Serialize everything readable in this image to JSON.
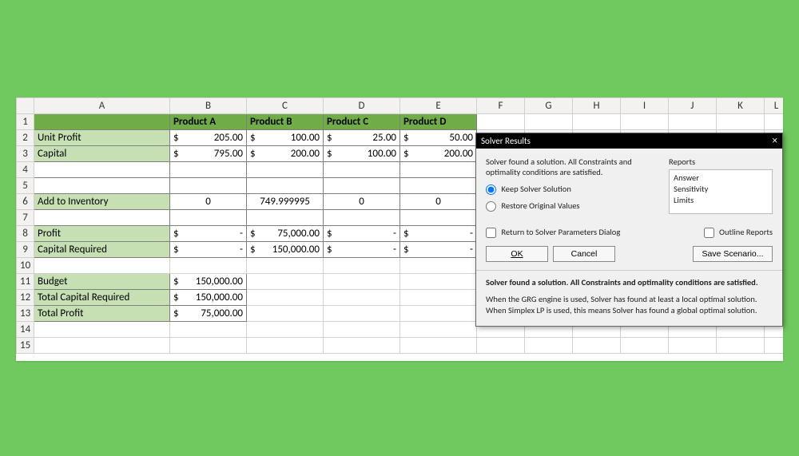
{
  "columns": [
    "A",
    "B",
    "C",
    "D",
    "E",
    "F",
    "G",
    "H",
    "I",
    "J",
    "K",
    "L"
  ],
  "selected_column": "G",
  "rows": [
    "1",
    "2",
    "3",
    "4",
    "5",
    "6",
    "7",
    "8",
    "9",
    "10",
    "11",
    "12",
    "13",
    "14",
    "15"
  ],
  "headers": {
    "B": "Product A",
    "C": "Product B",
    "D": "Product C",
    "E": "Product D"
  },
  "labels": {
    "unit_profit": "Unit Profit",
    "capital": "Capital",
    "add_inventory": "Add to Inventory",
    "profit": "Profit",
    "capital_required": "Capital Required",
    "budget": "Budget",
    "total_capital_required": "Total Capital Required",
    "total_profit": "Total Profit"
  },
  "data": {
    "unit_profit": {
      "B": "205.00",
      "C": "100.00",
      "D": "25.00",
      "E": "50.00"
    },
    "capital": {
      "B": "795.00",
      "C": "200.00",
      "D": "100.00",
      "E": "200.00"
    },
    "add_inventory": {
      "B": "0",
      "C": "749.999995",
      "D": "0",
      "E": "0"
    },
    "profit": {
      "B": "-",
      "C": "75,000.00",
      "D": "-",
      "E": "-"
    },
    "capital_req": {
      "B": "-",
      "C": "150,000.00",
      "D": "-",
      "E": "-"
    },
    "budget": "150,000.00",
    "total_capital_required": "150,000.00",
    "total_profit": "75,000.00"
  },
  "currency": "$",
  "dialog": {
    "title": "Solver Results",
    "msg": "Solver found a solution.  All Constraints and optimality conditions are satisfied.",
    "reports_label": "Reports",
    "reports": [
      "Answer",
      "Sensitivity",
      "Limits"
    ],
    "radios": {
      "keep": "Keep Solver Solution",
      "restore": "Restore Original Values",
      "selected": "keep"
    },
    "checks": {
      "return_dialog": "Return to Solver Parameters Dialog",
      "outline_reports": "Outline Reports"
    },
    "buttons": {
      "ok": "OK",
      "cancel": "Cancel",
      "save_scenario": "Save Scenario..."
    },
    "footer_bold": "Solver found a solution.  All Constraints and optimality conditions are satisfied.",
    "footer_detail": "When the GRG engine is used, Solver has found at least a local optimal solution. When Simplex LP is used, this means Solver has found a global optimal solution."
  },
  "chart_data": {
    "type": "table",
    "columns": [
      "Product A",
      "Product B",
      "Product C",
      "Product D"
    ],
    "rows": [
      {
        "label": "Unit Profit",
        "values": [
          205.0,
          100.0,
          25.0,
          50.0
        ]
      },
      {
        "label": "Capital",
        "values": [
          795.0,
          200.0,
          100.0,
          200.0
        ]
      },
      {
        "label": "Add to Inventory",
        "values": [
          0,
          749.999995,
          0,
          0
        ]
      },
      {
        "label": "Profit",
        "values": [
          0,
          75000.0,
          0,
          0
        ]
      },
      {
        "label": "Capital Required",
        "values": [
          0,
          150000.0,
          0,
          0
        ]
      }
    ],
    "summary": {
      "Budget": 150000.0,
      "Total Capital Required": 150000.0,
      "Total Profit": 75000.0
    }
  }
}
